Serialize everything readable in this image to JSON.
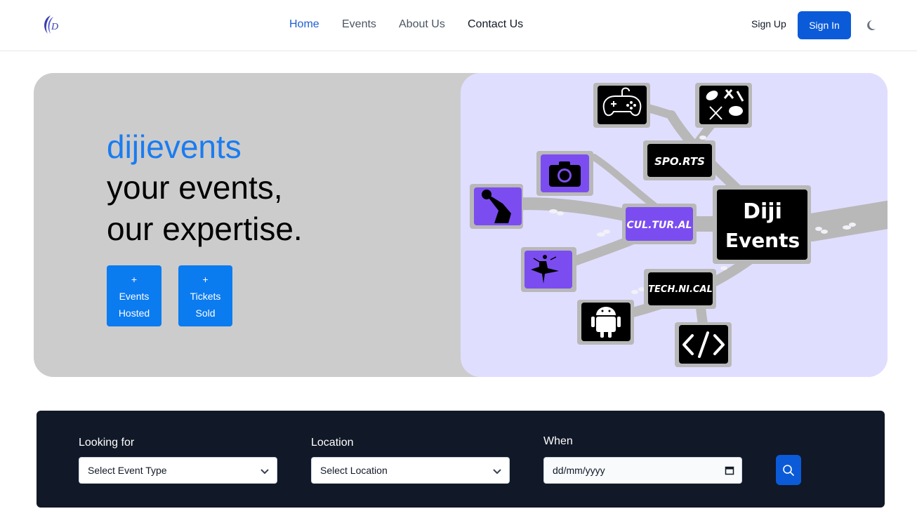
{
  "nav": {
    "home": "Home",
    "events": "Events",
    "about": "About Us",
    "contact": "Contact Us",
    "sign_up": "Sign Up",
    "sign_in": "Sign In"
  },
  "hero": {
    "brand": "dijievents",
    "tagline_1": "your events,",
    "tagline_2": "our expertise.",
    "stats": [
      {
        "plus": "+",
        "line1": "Events",
        "line2": "Hosted"
      },
      {
        "plus": "+",
        "line1": "Tickets",
        "line2": "Sold"
      }
    ],
    "graphic": {
      "center_line1": "Diji",
      "center_line2": "Events",
      "sports": "SPO.RTS",
      "cultural": "CUL.TUR.AL",
      "technical": "TECH.NI.CAL"
    }
  },
  "search": {
    "looking_for_label": "Looking for",
    "event_type_value": "Select Event Type",
    "location_label": "Location",
    "location_value": "Select Location",
    "when_label": "When",
    "date_value": "dd/mm/yyyy"
  },
  "colors": {
    "accent": "#0b5bd9",
    "brand_blue": "#1a7cf0",
    "panel": "#111827",
    "hero_gray": "#cccccc",
    "hero_lavender": "#e0defe",
    "purple": "#7b4df0"
  }
}
